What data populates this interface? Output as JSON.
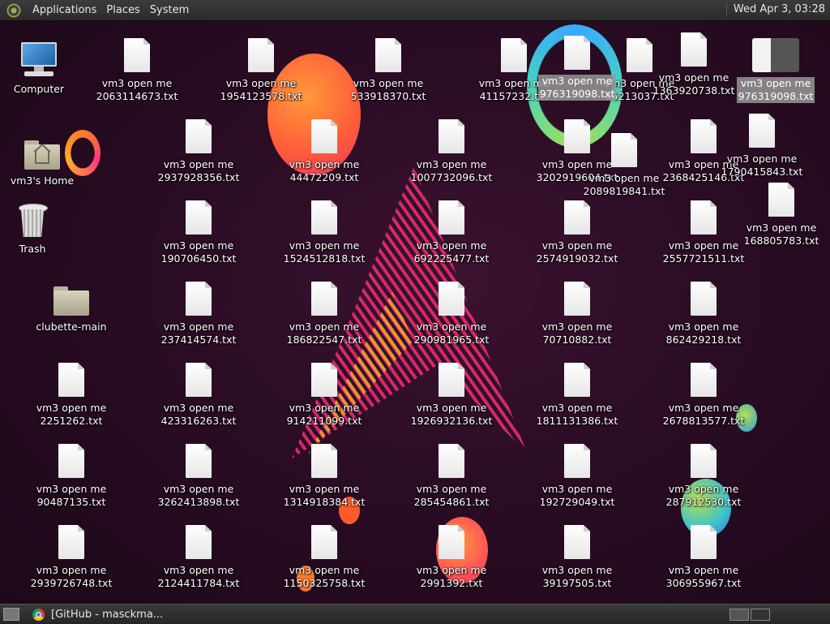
{
  "top_panel": {
    "menus": [
      "Applications",
      "Places",
      "System"
    ],
    "clock": "Wed Apr  3, 03:28"
  },
  "bottom_panel": {
    "task_label": "[GitHub - masckma..."
  },
  "system_icons": {
    "computer": "Computer",
    "home": "vm3's Home",
    "trash": "Trash",
    "folder": "clubette-main"
  },
  "files": [
    {
      "l1": "vm3 open me",
      "l2": "2063114673.txt"
    },
    {
      "l1": "vm3 open me",
      "l2": "1954123578.txt"
    },
    {
      "l1": "vm3 open me",
      "l2": "533918370.txt"
    },
    {
      "l1": "vm3 open me",
      "l2": "41157232.txt"
    },
    {
      "l1": "vm3 open me",
      "l2": "976319098.txt"
    },
    {
      "l1": "vm3 open me",
      "l2": "95213037.txt"
    },
    {
      "l1": "vm3 open me",
      "l2": "1363920738.txt"
    },
    {
      "l1": "vm3 open me",
      "l2": "976319098.txt"
    },
    {
      "l1": "vm3 open me",
      "l2": "2937928356.txt"
    },
    {
      "l1": "vm3 open me",
      "l2": "44472209.txt"
    },
    {
      "l1": "vm3 open me",
      "l2": "1007732096.txt"
    },
    {
      "l1": "vm3 open me",
      "l2": "3202919604.txt"
    },
    {
      "l1": "vm3 open me",
      "l2": "2089819841.txt"
    },
    {
      "l1": "vm3 open me",
      "l2": "2368425146.txt"
    },
    {
      "l1": "vm3 open me",
      "l2": "1790415843.txt"
    },
    {
      "l1": "vm3 open me",
      "l2": "190706450.txt"
    },
    {
      "l1": "vm3 open me",
      "l2": "1524512818.txt"
    },
    {
      "l1": "vm3 open me",
      "l2": "692225477.txt"
    },
    {
      "l1": "vm3 open me",
      "l2": "2574919032.txt"
    },
    {
      "l1": "vm3 open me",
      "l2": "2557721511.txt"
    },
    {
      "l1": "vm3 open me",
      "l2": "168805783.txt"
    },
    {
      "l1": "vm3 open me",
      "l2": "237414574.txt"
    },
    {
      "l1": "vm3 open me",
      "l2": "186822547.txt"
    },
    {
      "l1": "vm3 open me",
      "l2": "290981965.txt"
    },
    {
      "l1": "vm3 open me",
      "l2": "70710882.txt"
    },
    {
      "l1": "vm3 open me",
      "l2": "862429218.txt"
    },
    {
      "l1": "vm3 open me",
      "l2": "2251262.txt"
    },
    {
      "l1": "vm3 open me",
      "l2": "423316263.txt"
    },
    {
      "l1": "vm3 open me",
      "l2": "914211099.txt"
    },
    {
      "l1": "vm3 open me",
      "l2": "1926932136.txt"
    },
    {
      "l1": "vm3 open me",
      "l2": "1811131386.txt"
    },
    {
      "l1": "vm3 open me",
      "l2": "2678813577.txt"
    },
    {
      "l1": "vm3 open me",
      "l2": "90487135.txt"
    },
    {
      "l1": "vm3 open me",
      "l2": "3262413898.txt"
    },
    {
      "l1": "vm3 open me",
      "l2": "1314918384.txt"
    },
    {
      "l1": "vm3 open me",
      "l2": "285454861.txt"
    },
    {
      "l1": "vm3 open me",
      "l2": "192729049.txt"
    },
    {
      "l1": "vm3 open me",
      "l2": "287912530.txt"
    },
    {
      "l1": "vm3 open me",
      "l2": "2939726748.txt"
    },
    {
      "l1": "vm3 open me",
      "l2": "2124411784.txt"
    },
    {
      "l1": "vm3 open me",
      "l2": "1150325758.txt"
    },
    {
      "l1": "vm3 open me",
      "l2": "2991392.txt"
    },
    {
      "l1": "vm3 open me",
      "l2": "39197505.txt"
    },
    {
      "l1": "vm3 open me",
      "l2": "306955967.txt"
    }
  ]
}
